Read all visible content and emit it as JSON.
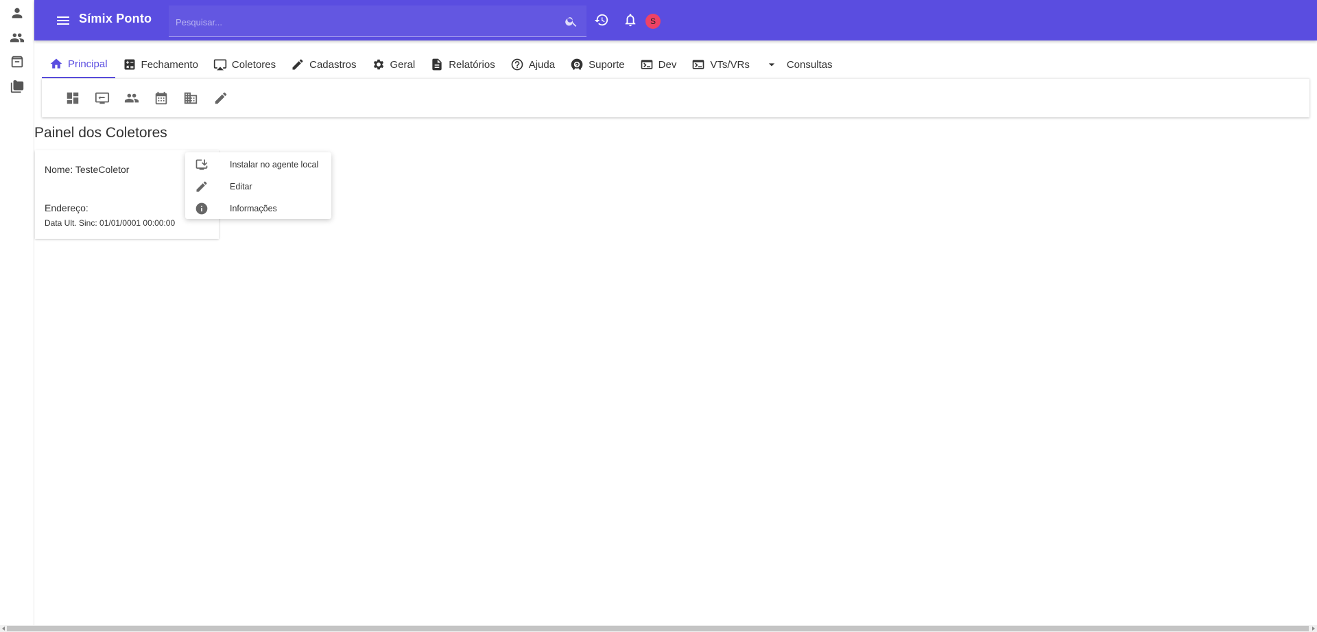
{
  "app": {
    "title": "Símix Ponto"
  },
  "header": {
    "search_placeholder": "Pesquisar...",
    "avatar_letter": "S",
    "accent_color": "#5a4de0",
    "avatar_color": "#ee4266"
  },
  "rail": {
    "icons": [
      "person-icon",
      "people-icon",
      "archive-icon",
      "folder-icon"
    ]
  },
  "tabs": [
    {
      "label": "Principal",
      "icon": "home-icon",
      "active": true
    },
    {
      "label": "Fechamento",
      "icon": "calculator-icon"
    },
    {
      "label": "Coletores",
      "icon": "monitor-icon"
    },
    {
      "label": "Cadastros",
      "icon": "pencil-icon"
    },
    {
      "label": "Geral",
      "icon": "gear-icon"
    },
    {
      "label": "Relatórios",
      "icon": "document-icon"
    },
    {
      "label": "Ajuda",
      "icon": "help-icon"
    },
    {
      "label": "Suporte",
      "icon": "support-icon"
    },
    {
      "label": "Dev",
      "icon": "terminal-icon"
    },
    {
      "label": "VTs/VRs",
      "icon": "terminal-icon"
    },
    {
      "label": "Consultas",
      "icon": "caret-down-icon"
    }
  ],
  "toolbar": {
    "icons": [
      "dashboard-icon",
      "monitor-swap-icon",
      "people-icon",
      "calendar-icon",
      "building-icon",
      "pencil-icon"
    ]
  },
  "page": {
    "title": "Painel dos Coletores"
  },
  "card": {
    "name": "Nome: TesteColetor",
    "address": "Endereço:",
    "sync": "Data Ult. Sinc: 01/01/0001 00:00:00"
  },
  "context_menu": {
    "items": [
      {
        "label": "Instalar no agente local",
        "icon": "install-icon"
      },
      {
        "label": "Editar",
        "icon": "pencil-icon"
      },
      {
        "label": "Informações",
        "icon": "info-icon"
      }
    ]
  }
}
